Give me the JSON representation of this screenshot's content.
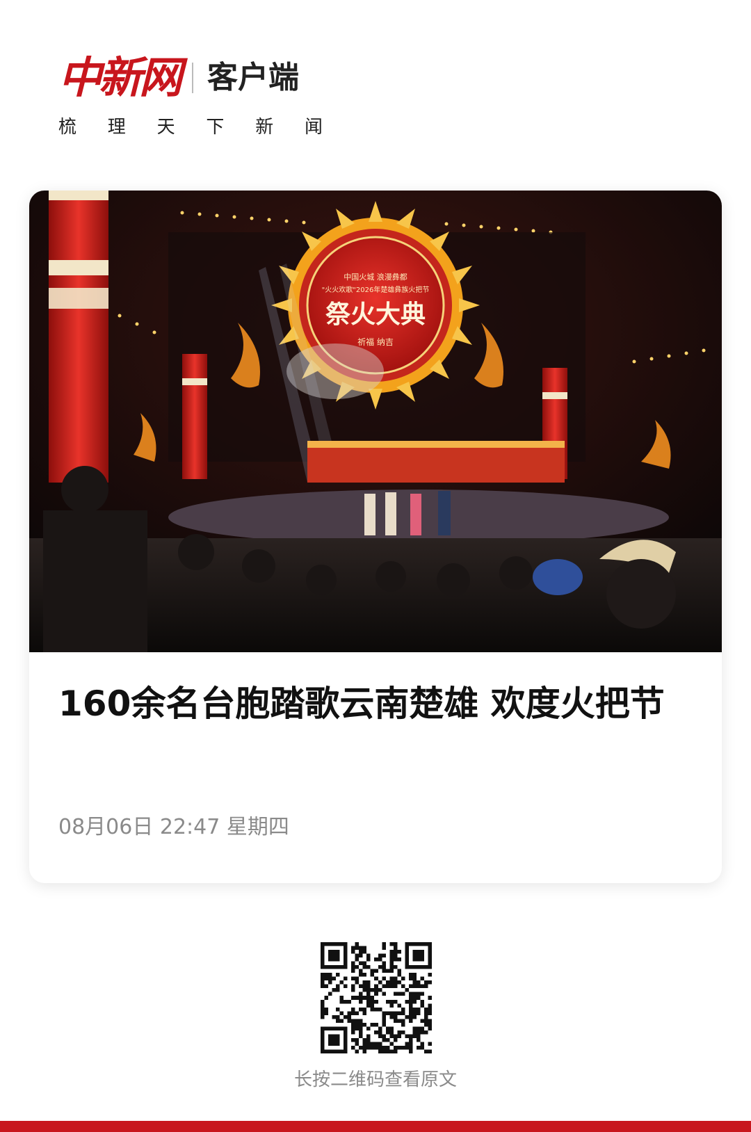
{
  "header": {
    "brand": "中新网",
    "client_label": "客户端",
    "slogan": [
      "梳",
      "理",
      "天",
      "下",
      "新",
      "闻"
    ]
  },
  "article": {
    "title": "160余名台胞踏歌云南楚雄  欢度火把节",
    "date": "08月06日 22:47 星期四",
    "image": {
      "screen_title": "祭火大典",
      "screen_line1": "中国火城  浪漫彝都",
      "screen_line2": "\"火火欢歌\"2026年楚雄彝族火把节",
      "screen_sub": "祈福 纳吉"
    }
  },
  "qr": {
    "caption": "长按二维码查看原文"
  },
  "colors": {
    "brand_red": "#c8161d",
    "meta_gray": "#8a8a8a"
  }
}
